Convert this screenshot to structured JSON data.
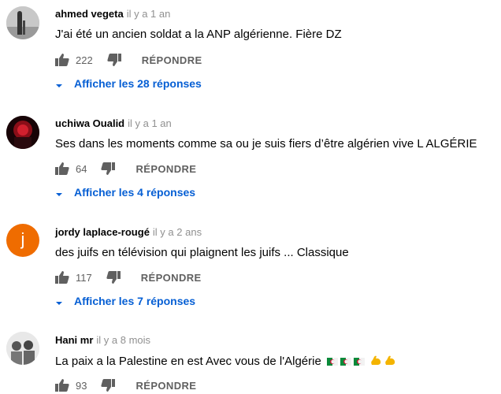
{
  "comments": [
    {
      "author": "ahmed vegeta",
      "time": "il y a 1 an",
      "text": "J'ai été un ancien soldat a la ANP algérienne. Fière DZ",
      "likes": "222",
      "reply_label": "RÉPONDRE",
      "replies_label": "Afficher les 28 réponses"
    },
    {
      "author": "uchiwa Oualid",
      "time": "il y a 1 an",
      "text": "Ses dans les moments comme sa ou je suis fiers d’être algérien vive L ALGÉRIE",
      "likes": "64",
      "reply_label": "RÉPONDRE",
      "replies_label": "Afficher les 4 réponses"
    },
    {
      "author": "jordy laplace-rougé",
      "time": "il y a 2 ans",
      "avatar_letter": "j",
      "text": "des juifs en télévision qui plaignent les juifs ... Classique",
      "likes": "117",
      "reply_label": "RÉPONDRE",
      "replies_label": "Afficher les 7 réponses"
    },
    {
      "author": "Hani mr",
      "time": "il y a 8 mois",
      "text": "La paix a la Palestine en est Avec vous de l'Algérie",
      "likes": "93",
      "reply_label": "RÉPONDRE"
    }
  ],
  "colors": {
    "link_blue": "#065fd4",
    "meta_grey": "#909090",
    "action_grey": "#606060",
    "avatar_orange": "#ef6c00"
  }
}
